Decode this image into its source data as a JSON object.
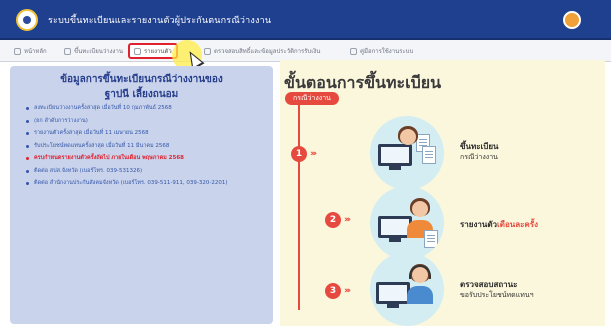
{
  "window": {
    "app_title": "ระบบขึ้นทะเบียนและรายงานตัวผู้ประกันตนกรณีว่างงาน"
  },
  "tabs": [
    {
      "label": "หน้าหลัก",
      "icon": "home-icon"
    },
    {
      "label": "ขึ้นทะเบียนว่างงาน",
      "icon": "document-icon"
    },
    {
      "label": "รายงานตัว",
      "icon": "person-icon",
      "active": true
    },
    {
      "label": "ตรวจสอบสิทธิ์และข้อมูลประวัติการรับเงิน",
      "icon": "search-icon"
    },
    {
      "label": "คู่มือการใช้งานระบบ",
      "icon": "book-icon"
    }
  ],
  "left_panel": {
    "title": "ข้อมูลการขึ้นทะเบียนกรณีว่างงานของ",
    "subtitle": "ฐาปนี เลี้ยงถนอม",
    "items": [
      {
        "text": "ลงทะเบียนว่างงานครั้งล่าสุด เมื่อวันที่ 10 กุมภาพันธ์ 2568",
        "highlight": false
      },
      {
        "text": "(ยก ลำดับการว่างงาน)",
        "highlight": false
      },
      {
        "text": "รายงานตัวครั้งล่าสุด เมื่อวันที่ 11 เมษายน 2568",
        "highlight": false
      },
      {
        "text": "รับประโยชน์ทดแทนครั้งล่าสุด เมื่อวันที่ 11 มีนาคม 2568",
        "highlight": false
      },
      {
        "text": "ครบกำหนดรายงานตัวครั้งถัดไป ภายในเดือน พฤษภาคม 2568",
        "highlight": true
      },
      {
        "text": "ติดต่อ สปส.จังหวัด (เบอร์โทร. 039-531326)",
        "highlight": false
      },
      {
        "text": "ติดต่อ สำนักงานประกันสังคมจังหวัด (เบอร์โทร. 039-511-911, 039-320-2201)",
        "highlight": false
      }
    ]
  },
  "right_panel": {
    "title": "ขั้นตอนการขึ้นทะเบียน",
    "case_badge": "กรณีว่างงาน",
    "steps": [
      {
        "number": "1",
        "label": "ขึ้นทะเบียน",
        "sub": "กรณีว่างงาน"
      },
      {
        "number": "2",
        "label_prefix": "รายงานตัว",
        "label_highlight": "เดือนละครั้ง",
        "sub": ""
      },
      {
        "number": "3",
        "label": "ตรวจสอบสถานะ",
        "sub": "ขอรับประโยชน์ทดแทนฯ"
      }
    ]
  },
  "colors": {
    "topbar": "#1f3f8f",
    "accent_red": "#e64a3f",
    "panel_blue": "#c9d4ec",
    "panel_cream": "#fbf7dd"
  }
}
